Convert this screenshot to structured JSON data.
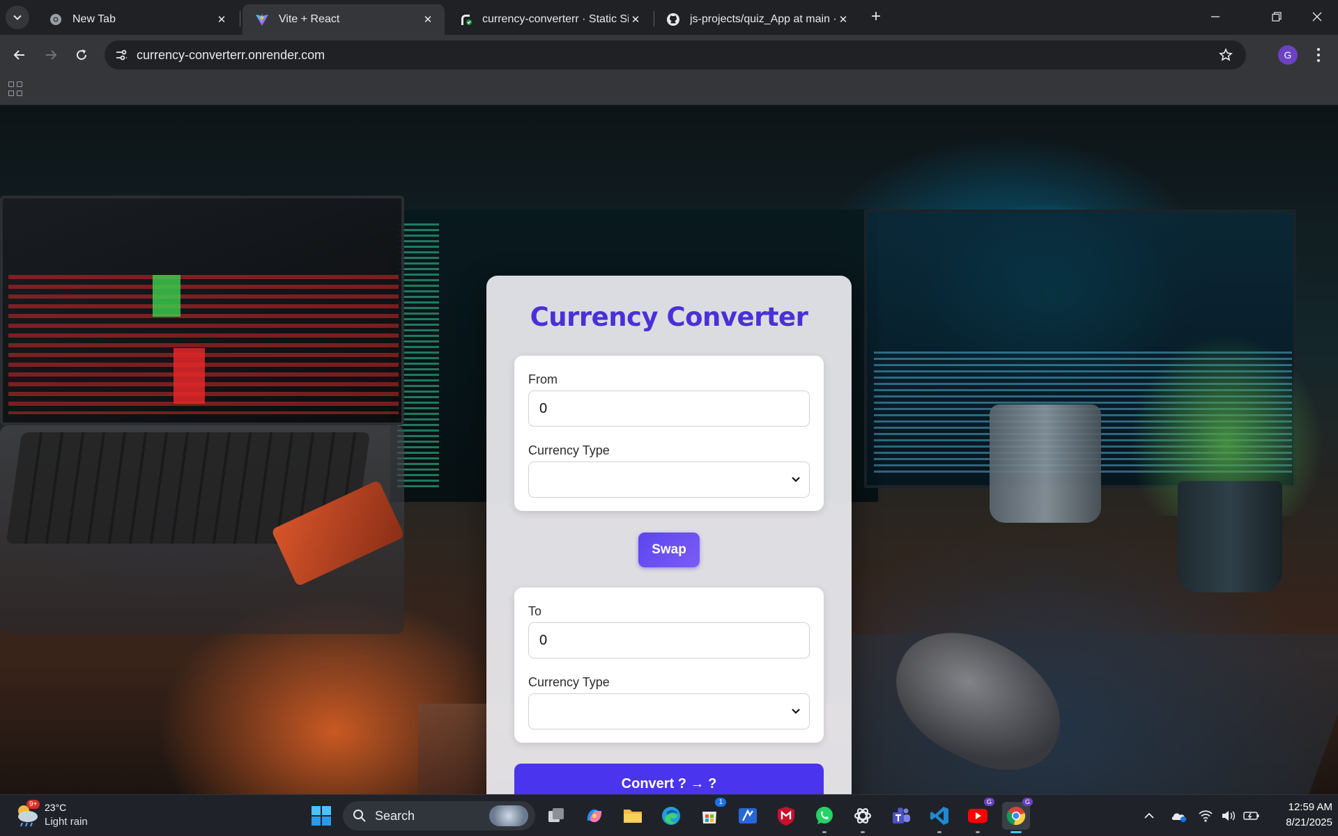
{
  "browser": {
    "tabs": [
      {
        "title": "New Tab",
        "icon": "chrome-icon"
      },
      {
        "title": "Vite + React",
        "icon": "vite-icon",
        "active": true
      },
      {
        "title": "currency-converterr · Static Site",
        "icon": "render-icon"
      },
      {
        "title": "js-projects/quiz_App at main · g",
        "icon": "github-icon"
      }
    ],
    "url": "currency-converterr.onrender.com",
    "profile_initial": "G"
  },
  "app": {
    "title": "Currency Converter",
    "from": {
      "label": "From",
      "amount": "0",
      "currency_label": "Currency Type",
      "currency_value": ""
    },
    "swap_label": "Swap",
    "to": {
      "label": "To",
      "amount": "0",
      "currency_label": "Currency Type",
      "currency_value": ""
    },
    "convert_label": "Convert ? → ?"
  },
  "taskbar": {
    "weather": {
      "temp": "23°C",
      "condition": "Light rain",
      "badge": "9+"
    },
    "search_label": "Search",
    "store_badge": "1",
    "time": "12:59 AM",
    "date": "8/21/2025"
  },
  "colors": {
    "accent": "#4b2fd8",
    "button": "#4a34ee",
    "swap_button": "#6a50f2"
  }
}
